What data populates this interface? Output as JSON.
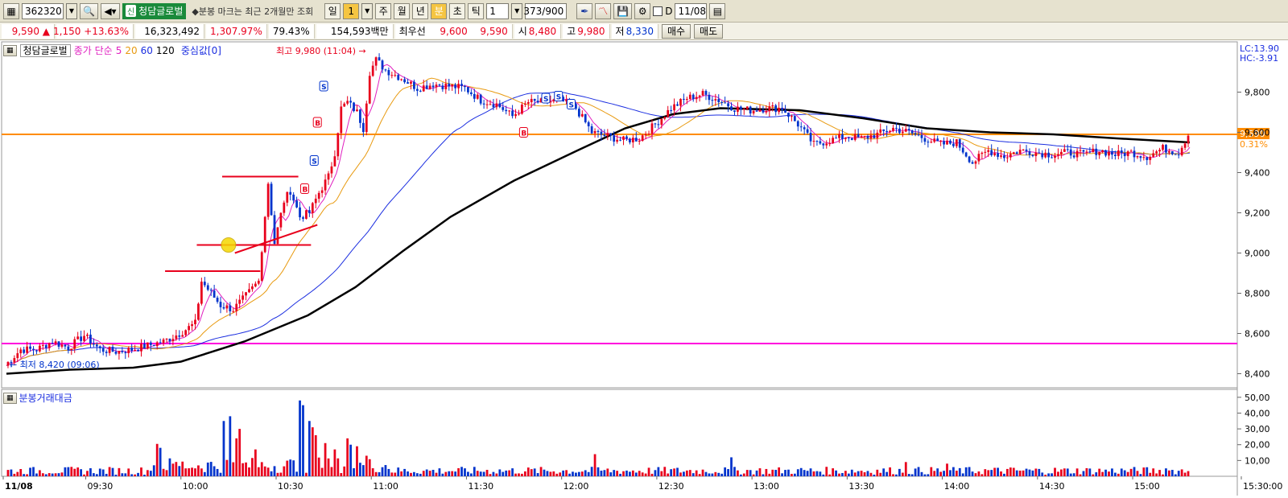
{
  "toolbar": {
    "code": "362320",
    "stock_name_prefix": "신",
    "stock_name": "청담글로벌",
    "notice": "◆분봉 마크는 최근 2개월만 조회",
    "periods": [
      "일",
      "1",
      "주",
      "월",
      "년",
      "분",
      "초",
      "틱"
    ],
    "interval": "1",
    "count": "373/900",
    "date_check": "D",
    "date": "11/08"
  },
  "quote": {
    "price": "9,590",
    "change": "1,150",
    "change_pct": "+13.63%",
    "volume": "16,323,492",
    "volume_pct": "1,307.97%",
    "turnover_pct": "79.43%",
    "amount": "154,593백만",
    "best_label": "최우선",
    "ask": "9,600",
    "bid": "9,590",
    "open_label": "시",
    "open": "8,480",
    "high_label": "고",
    "high": "9,980",
    "low_label": "저",
    "low": "8,330",
    "buy_btn": "매수",
    "sell_btn": "매도"
  },
  "legend": {
    "name": "청담글로벌",
    "ma_label": "종가 단순",
    "ma5": "5",
    "ma20": "20",
    "ma60": "60",
    "ma120": "120",
    "center": "중심값[0]"
  },
  "volume_legend": "분봉거래대금",
  "colors": {
    "up": "#e8001c",
    "down": "#0033cc",
    "ma5": "#e020c0",
    "ma20": "#e89a10",
    "ma60": "#1b2ee0",
    "ma120": "#000000",
    "ref_orange": "#ff8c00",
    "ref_magenta": "#ff00dd"
  },
  "chart_data": {
    "type": "candlestick",
    "price_axis": {
      "ticks": [
        9800,
        9600,
        9400,
        9200,
        9000,
        8800,
        8600,
        8400
      ],
      "ylim": [
        8330,
        10050
      ]
    },
    "volume_axis": {
      "ticks": [
        "50,00",
        "40,00",
        "30,00",
        "20,00",
        "10,00"
      ],
      "ylim": [
        0,
        55
      ]
    },
    "time_axis": [
      "11/08",
      "09:30",
      "10:00",
      "10:30",
      "11:00",
      "11:30",
      "12:00",
      "12:30",
      "13:00",
      "13:30",
      "14:00",
      "14:30",
      "15:00",
      "15:30:00"
    ],
    "top_right": [
      "LC:13.90",
      "HC:-3.91"
    ],
    "current_price_label": "9,590",
    "current_pct_label": "0.31%",
    "annotations": {
      "high": "최고 9,980 (11:04)",
      "low": "최저 8,420 (09:06)"
    },
    "ref_lines": {
      "orange": 9590,
      "magenta": 8550
    },
    "price_path": [
      [
        0,
        8440
      ],
      [
        5,
        8520
      ],
      [
        10,
        8520
      ],
      [
        15,
        8560
      ],
      [
        20,
        8530
      ],
      [
        25,
        8590
      ],
      [
        30,
        8520
      ],
      [
        35,
        8510
      ],
      [
        40,
        8520
      ],
      [
        45,
        8540
      ],
      [
        50,
        8560
      ],
      [
        55,
        8600
      ],
      [
        60,
        8650
      ],
      [
        62,
        8860
      ],
      [
        65,
        8800
      ],
      [
        68,
        8740
      ],
      [
        72,
        8720
      ],
      [
        75,
        8770
      ],
      [
        80,
        8860
      ],
      [
        83,
        9350
      ],
      [
        85,
        9050
      ],
      [
        88,
        9260
      ],
      [
        90,
        9310
      ],
      [
        93,
        9180
      ],
      [
        96,
        9200
      ],
      [
        99,
        9300
      ],
      [
        102,
        9380
      ],
      [
        104,
        9500
      ],
      [
        106,
        9720
      ],
      [
        108,
        9750
      ],
      [
        111,
        9700
      ],
      [
        113,
        9620
      ],
      [
        115,
        9900
      ],
      [
        117,
        9960
      ],
      [
        120,
        9910
      ],
      [
        125,
        9870
      ],
      [
        130,
        9820
      ],
      [
        135,
        9840
      ],
      [
        140,
        9830
      ],
      [
        145,
        9820
      ],
      [
        150,
        9760
      ],
      [
        155,
        9740
      ],
      [
        160,
        9680
      ],
      [
        165,
        9750
      ],
      [
        170,
        9750
      ],
      [
        175,
        9760
      ],
      [
        180,
        9720
      ],
      [
        185,
        9600
      ],
      [
        190,
        9580
      ],
      [
        195,
        9560
      ],
      [
        200,
        9570
      ],
      [
        205,
        9640
      ],
      [
        210,
        9720
      ],
      [
        215,
        9770
      ],
      [
        220,
        9790
      ],
      [
        225,
        9760
      ],
      [
        230,
        9720
      ],
      [
        235,
        9710
      ],
      [
        240,
        9720
      ],
      [
        245,
        9720
      ],
      [
        250,
        9640
      ],
      [
        255,
        9540
      ],
      [
        260,
        9560
      ],
      [
        265,
        9580
      ],
      [
        270,
        9570
      ],
      [
        275,
        9590
      ],
      [
        280,
        9620
      ],
      [
        285,
        9600
      ],
      [
        290,
        9570
      ],
      [
        295,
        9540
      ],
      [
        300,
        9550
      ],
      [
        305,
        9450
      ],
      [
        310,
        9510
      ],
      [
        315,
        9480
      ],
      [
        320,
        9510
      ],
      [
        325,
        9500
      ],
      [
        330,
        9490
      ],
      [
        335,
        9500
      ],
      [
        340,
        9490
      ],
      [
        345,
        9510
      ],
      [
        350,
        9490
      ],
      [
        355,
        9500
      ],
      [
        360,
        9480
      ],
      [
        365,
        9520
      ],
      [
        370,
        9500
      ],
      [
        373,
        9590
      ]
    ],
    "ma120_path": [
      [
        0,
        8400
      ],
      [
        20,
        8420
      ],
      [
        40,
        8430
      ],
      [
        55,
        8460
      ],
      [
        75,
        8560
      ],
      [
        95,
        8690
      ],
      [
        110,
        8830
      ],
      [
        125,
        9010
      ],
      [
        140,
        9180
      ],
      [
        160,
        9360
      ],
      [
        180,
        9510
      ],
      [
        195,
        9620
      ],
      [
        210,
        9690
      ],
      [
        225,
        9720
      ],
      [
        250,
        9710
      ],
      [
        270,
        9670
      ],
      [
        290,
        9620
      ],
      [
        310,
        9600
      ],
      [
        330,
        9590
      ],
      [
        350,
        9570
      ],
      [
        373,
        9550
      ]
    ],
    "volume_bars": [
      [
        47,
        20.5
      ],
      [
        48,
        18
      ],
      [
        52,
        8
      ],
      [
        56,
        5
      ],
      [
        68,
        35
      ],
      [
        70,
        38
      ],
      [
        72,
        24
      ],
      [
        73,
        30
      ],
      [
        78,
        17
      ],
      [
        92,
        48
      ],
      [
        93,
        45
      ],
      [
        95,
        35
      ],
      [
        96,
        31
      ],
      [
        97,
        26
      ],
      [
        100,
        21
      ],
      [
        103,
        17
      ],
      [
        107,
        24
      ],
      [
        108,
        20
      ],
      [
        110,
        19
      ],
      [
        113,
        13
      ],
      [
        185,
        14
      ],
      [
        228,
        12
      ],
      [
        283,
        9
      ],
      [
        296,
        8
      ],
      [
        365,
        5
      ],
      [
        373,
        13
      ]
    ]
  }
}
